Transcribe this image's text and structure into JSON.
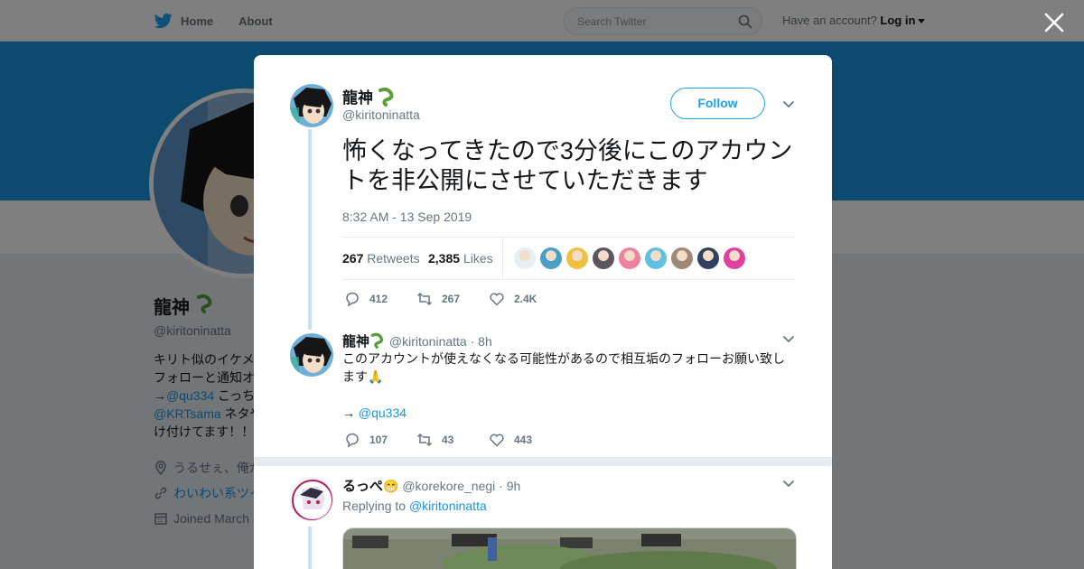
{
  "nav": {
    "home": "Home",
    "about": "About",
    "search_placeholder": "Search Twitter",
    "account_prompt": "Have an account?",
    "login": "Log in"
  },
  "profile": {
    "name": "龍神",
    "handle": "@kiritoninatta",
    "bio_line1": "キリト似のイケメ",
    "bio_line2": "フォローと通知オ",
    "bio_line3_prefix": "→",
    "bio_link1": "@qu334",
    "bio_line3_suffix": " こっち",
    "bio_link2": "@KRTsama",
    "bio_line4_suffix": " ネタや",
    "bio_line5": "け付けてます！！",
    "location": "うるせぇ、俺が",
    "website": "わいわい系ツイ",
    "joined": "Joined March"
  },
  "tweet": {
    "author_name": "龍神",
    "author_handle": "@kiritoninatta",
    "follow_label": "Follow",
    "text": "怖くなってきたので3分後にこのアカウントを非公開にさせていただきます",
    "timestamp": "8:32 AM - 13 Sep 2019",
    "retweets_count": "267",
    "retweets_label": "Retweets",
    "likes_count": "2,385",
    "likes_label": "Likes",
    "replies_action": "412",
    "retweets_action": "267",
    "likes_action": "2.4K",
    "liker_colors": [
      "#e8eef3",
      "#4a9fc7",
      "#f0c040",
      "#5a5560",
      "#f080a0",
      "#60c0e0",
      "#a08878",
      "#304060",
      "#e040a0"
    ]
  },
  "reply1": {
    "name": "龍神",
    "handle": "@kiritoninatta",
    "time": "· 8h",
    "text": "このアカウントが使えなくなる可能性があるので相互垢のフォローお願い致します",
    "emoji": "🙏",
    "arrow": "→",
    "link": "@qu334",
    "replies": "107",
    "retweets": "43",
    "likes": "443"
  },
  "reply2": {
    "name": "るっぺ",
    "emoji": "😁",
    "handle": "@korekore_negi",
    "time": "· 9h",
    "replying_label": "Replying to",
    "replying_to": "@kiritoninatta"
  },
  "colors": {
    "accent": "#1da1f2",
    "link": "#1b95e0",
    "muted": "#657786",
    "banner": "#1b95e0",
    "thread_line": "#c4e2f6"
  }
}
